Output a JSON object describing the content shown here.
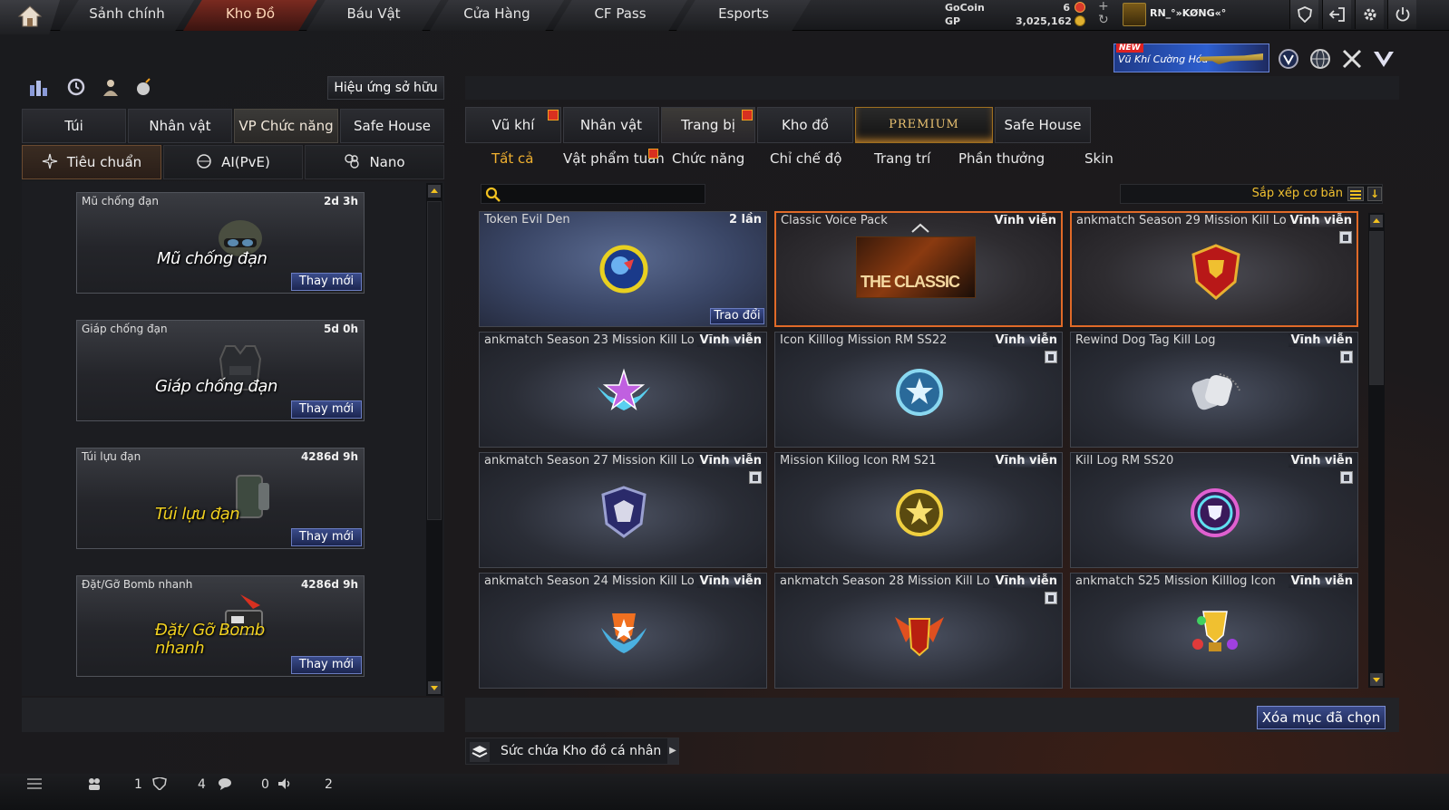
{
  "colors": {
    "accent": "#f0b030",
    "selected_border": "#e06a28",
    "button_blue": "#2c3c78"
  },
  "top_nav": {
    "tabs": [
      "Sảnh chính",
      "Kho Đồ",
      "Báu Vật",
      "Cửa Hàng",
      "CF Pass",
      "Esports"
    ],
    "active_index": 1
  },
  "currency": {
    "gocoin_label": "GoCoin",
    "gocoin_value": "6",
    "gp_label": "GP",
    "gp_value": "3,025,162"
  },
  "user": {
    "name": "RN_°»KØNG«°"
  },
  "system_icons": [
    "shield-icon",
    "exit-icon",
    "gear-icon",
    "power-icon"
  ],
  "promo": {
    "badge": "NEW",
    "text": "Vũ Khí Cường Hóa"
  },
  "left": {
    "tool_icons": [
      "ranking-icon",
      "history-icon",
      "character-icon",
      "bomb-icon"
    ],
    "effects_button": "Hiệu ứng sở hữu",
    "tabs": [
      "Túi",
      "Nhân vật",
      "VP Chức năng",
      "Safe House"
    ],
    "active_tab": 2,
    "subtabs": [
      "Tiêu chuẩn",
      "AI(PvE)",
      "Nano"
    ],
    "active_subtab": 0,
    "equipment": [
      {
        "name": "Mũ chống đạn",
        "time": "2d 3h",
        "big": "Mũ chống đạn",
        "renew": "Thay mới"
      },
      {
        "name": "Giáp chống đạn",
        "time": "5d 0h",
        "big": "Giáp chống đạn",
        "renew": "Thay mới"
      },
      {
        "name": "Túi lựu đạn",
        "time": "4286d 9h",
        "big": "Túi lựu đạn",
        "renew": "Thay mới"
      },
      {
        "name": "Đặt/Gỡ Bomb nhanh",
        "time": "4286d 9h",
        "big": "Đặt/ Gỡ Bomb nhanh",
        "renew": "Thay mới"
      }
    ]
  },
  "right": {
    "tabs": [
      "Vũ khí",
      "Nhân vật",
      "Trang bị",
      "Kho đồ",
      "PREMIUM",
      "Safe House"
    ],
    "active_tab": 2,
    "subtabs": [
      "Tất cả",
      "Vật phẩm tuần",
      "Chức năng",
      "Chỉ chế độ",
      "Trang trí",
      "Phần thưởng",
      "Skin"
    ],
    "active_subtab": 0,
    "search_placeholder": "",
    "sort_label": "Sắp xếp cơ bản",
    "items": [
      {
        "name": "Token Evil Den",
        "duration": "2 lần",
        "action": "Trao đổi"
      },
      {
        "name": "Classic Voice Pack",
        "duration": "Vĩnh viễn",
        "art_text": "THE CLASSIC"
      },
      {
        "name": "ankmatch Season 29 Mission Kill Lo",
        "duration": "Vĩnh viễn"
      },
      {
        "name": "ankmatch Season 23 Mission Kill Lo",
        "duration": "Vĩnh viễn"
      },
      {
        "name": "Icon Killlog Mission RM SS22",
        "duration": "Vĩnh viễn"
      },
      {
        "name": "Rewind Dog Tag Kill Log",
        "duration": "Vĩnh viễn"
      },
      {
        "name": "ankmatch Season 27 Mission Kill Lo",
        "duration": "Vĩnh viễn"
      },
      {
        "name": "Mission Killog Icon RM S21",
        "duration": "Vĩnh viễn"
      },
      {
        "name": "Kill Log RM SS20",
        "duration": "Vĩnh viễn"
      },
      {
        "name": "ankmatch Season 24 Mission Kill Lo",
        "duration": "Vĩnh viễn"
      },
      {
        "name": "ankmatch Season 28 Mission Kill Lo",
        "duration": "Vĩnh viễn"
      },
      {
        "name": "ankmatch S25 Mission Killlog Icon",
        "duration": "Vĩnh viễn"
      }
    ],
    "delete_button": "Xóa mục đã chọn",
    "capacity_label": "Sức chứa Kho đồ cá nhân"
  },
  "status_bar": {
    "friends": "1",
    "clan": "4",
    "chat": "0",
    "voice": "2"
  }
}
